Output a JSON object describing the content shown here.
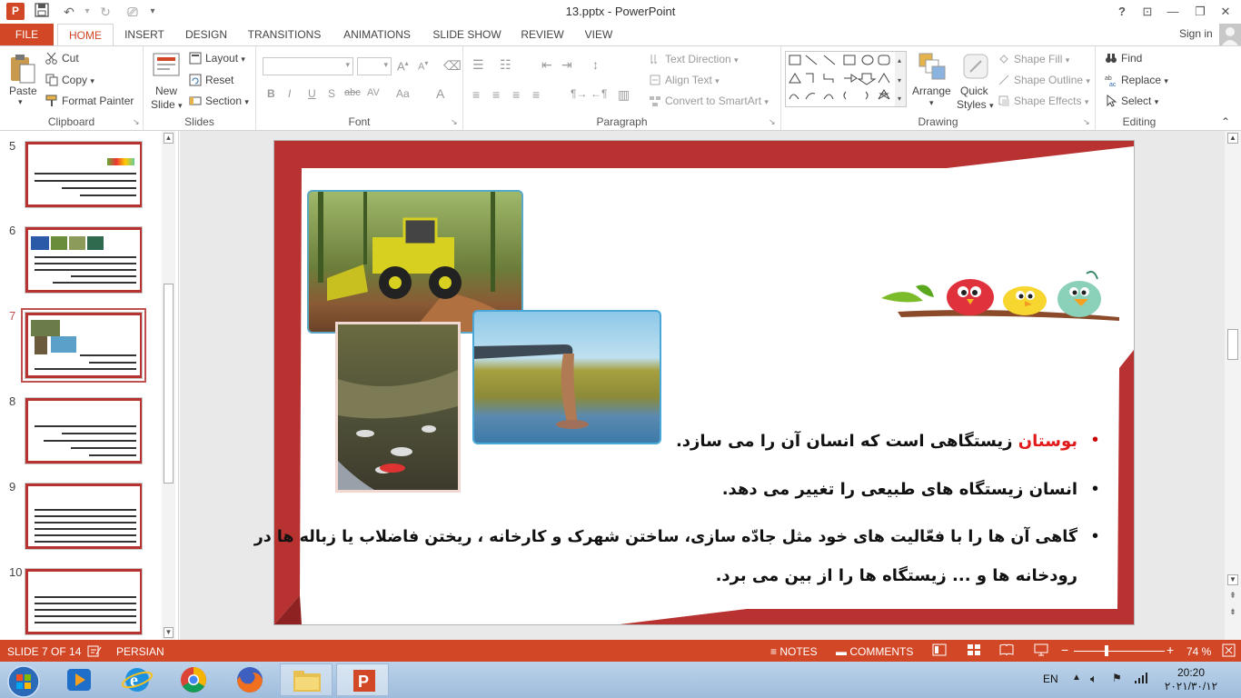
{
  "window": {
    "title": "13.pptx - PowerPoint",
    "app_logo": "P",
    "help": "?"
  },
  "qat": {
    "save_icon": "save-icon",
    "undo_icon": "undo-icon",
    "redo_icon": "redo-icon"
  },
  "tabs": [
    {
      "label": "FILE"
    },
    {
      "label": "HOME"
    },
    {
      "label": "INSERT"
    },
    {
      "label": "DESIGN"
    },
    {
      "label": "TRANSITIONS"
    },
    {
      "label": "ANIMATIONS"
    },
    {
      "label": "SLIDE SHOW"
    },
    {
      "label": "REVIEW"
    },
    {
      "label": "VIEW"
    }
  ],
  "account": {
    "signin": "Sign in"
  },
  "ribbon": {
    "clipboard": {
      "label": "Clipboard",
      "paste": "Paste",
      "cut": "Cut",
      "copy": "Copy",
      "format_painter": "Format Painter"
    },
    "slides": {
      "label": "Slides",
      "new_slide": "New",
      "new_slide2": "Slide",
      "layout": "Layout",
      "reset": "Reset",
      "section": "Section"
    },
    "font": {
      "label": "Font",
      "bold": "B",
      "italic": "I",
      "underline": "U",
      "shadow": "S",
      "strike": "abc",
      "spacing": "AV",
      "case": "Aa",
      "color": "A"
    },
    "paragraph": {
      "label": "Paragraph",
      "text_direction": "Text Direction",
      "align_text": "Align Text",
      "smartart": "Convert to SmartArt"
    },
    "drawing": {
      "label": "Drawing",
      "arrange": "Arrange",
      "quick_styles": "Quick",
      "quick_styles2": "Styles",
      "shape_fill": "Shape Fill",
      "shape_outline": "Shape Outline",
      "shape_effects": "Shape Effects"
    },
    "editing": {
      "label": "Editing",
      "find": "Find",
      "replace": "Replace",
      "select": "Select"
    }
  },
  "thumbnails": [
    {
      "num": "5"
    },
    {
      "num": "6"
    },
    {
      "num": "7"
    },
    {
      "num": "8"
    },
    {
      "num": "9"
    },
    {
      "num": "10"
    }
  ],
  "slide": {
    "bullet1_red": "بوستان",
    "bullet1_rest": " زیستگاهی است که انسان آن را می سازد.",
    "bullet2": "انسان زیستگاه های طبیعی را تغییر می دهد.",
    "bullet3_line1": "گاهی آن ها را با فعّالیت های خود مثل جادّه سازی، ساختن شهرک و کارخانه ، ریختن فاضلاب یا زباله ها در",
    "bullet3_line2": "رودخانه ها و ... زیستگاه ها را از بین می برد.",
    "accent_color": "#b83232",
    "highlight_color": "#e11b1b"
  },
  "status": {
    "slide_count": "SLIDE 7 OF 14",
    "language": "PERSIAN",
    "notes": "NOTES",
    "comments": "COMMENTS",
    "zoom": "74 %",
    "zoom_minus": "−",
    "zoom_plus": "+"
  },
  "taskbar": {
    "lang": "EN",
    "time": "20:20",
    "date": "۲۰۲۱/۳۰/۱۲"
  }
}
